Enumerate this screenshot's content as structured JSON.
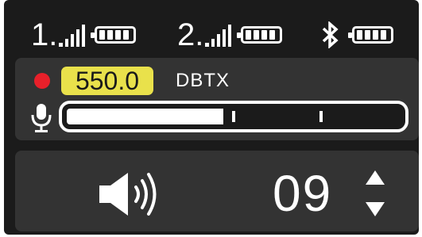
{
  "status": {
    "receiver1": {
      "label": "1.",
      "signal_bars": 4,
      "battery_cells": 4
    },
    "receiver2": {
      "label": "2.",
      "signal_bars": 4,
      "battery_cells": 4
    },
    "bluetooth": {
      "icon": "bluetooth-icon",
      "battery_cells": 4
    }
  },
  "channel": {
    "record_color": "#e8202a",
    "frequency": "550.0",
    "frequency_bg": "#e9e14b",
    "name": "DBTX",
    "audio_level": 0.47
  },
  "volume": {
    "value": "09",
    "icons": [
      "speaker-icon",
      "arrow-up-icon",
      "arrow-down-icon",
      "microphone-icon"
    ]
  }
}
